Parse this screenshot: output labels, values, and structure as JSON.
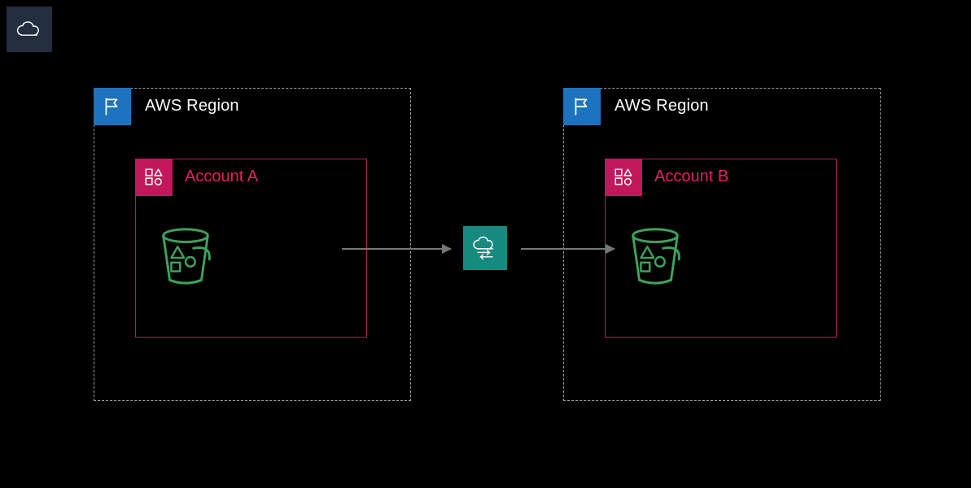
{
  "regions": {
    "a": {
      "label": "AWS Region",
      "account_label": "Account A"
    },
    "b": {
      "label": "AWS Region",
      "account_label": "Account B"
    }
  },
  "colors": {
    "region_flag_bg": "#1e73be",
    "account_border": "#c2185b",
    "account_text": "#e91e63",
    "bucket_stroke": "#4caf50",
    "transfer_bg": "#178a80",
    "cloud_badge_bg": "#232f3e"
  }
}
